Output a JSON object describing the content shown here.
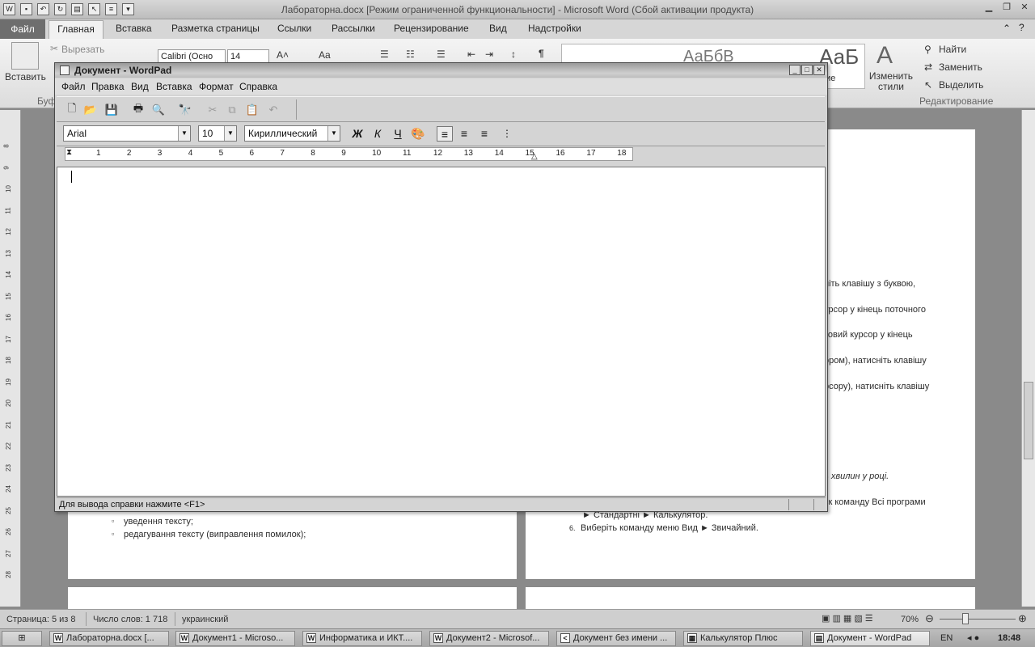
{
  "word": {
    "title": "Лабораторна.docx [Режим ограниченной функциональности]  -  Microsoft Word (Сбой активации продукта)",
    "tabs": [
      "Файл",
      "Главная",
      "Вставка",
      "Разметка страницы",
      "Ссылки",
      "Рассылки",
      "Рецензирование",
      "Вид",
      "Надстройки"
    ],
    "ribbon": {
      "paste": "Вставить",
      "cut": "Вырезать",
      "clipboard_group": "Буф",
      "font_name": "Calibri (Осно",
      "font_size": "14",
      "styles_group_tail": "ние",
      "change_styles": "Изменить стили",
      "find": "Найти",
      "replace": "Заменить",
      "select": "Выделить",
      "editing_group": "Редактирование",
      "style_sample_big": "АаБ"
    },
    "vruler_numbers": [
      "8",
      "9",
      "10",
      "11",
      "12",
      "13",
      "14",
      "15",
      "16",
      "17",
      "18",
      "19",
      "20",
      "21",
      "22",
      "23",
      "24",
      "25",
      "26",
      "27",
      "28"
    ],
    "doc_right_lines": [
      "ніть  клавішу  з  буквою,",
      "урсор у кінець поточного",
      "товий  курсор  у  кінець",
      "ором), натисніть клавішу",
      "рсору), натисніть клавішу"
    ],
    "doc_right_italic": "ь хвилин у році.",
    "doc_right_programs": "ск команду Всі програми",
    "doc_right_calc": "► Стандартні ► Калькулятор.",
    "doc_right_step6_num": "6.",
    "doc_right_step6": "Виберіть команду меню Вид ► Звичайний.",
    "doc_left_bullets": [
      "уведення тексту;",
      "редагування тексту (виправлення помилок);"
    ],
    "status": {
      "page": "Страница: 5 из 8",
      "words": "Число слов: 1 718",
      "language": "украинский",
      "zoom": "70%"
    }
  },
  "wordpad": {
    "title": "Документ - WordPad",
    "menu": [
      "Файл",
      "Правка",
      "Вид",
      "Вставка",
      "Формат",
      "Справка"
    ],
    "font": "Arial",
    "size": "10",
    "script": "Кириллический",
    "bold": "Ж",
    "italic": "К",
    "underline": "Ч",
    "ruler_numbers": [
      "1",
      "2",
      "3",
      "4",
      "5",
      "6",
      "7",
      "8",
      "9",
      "10",
      "11",
      "12",
      "13",
      "14",
      "15",
      "16",
      "17",
      "18"
    ],
    "status_text": "Для вывода справки нажмите <F1>"
  },
  "taskbar": {
    "items": [
      {
        "icon": "W",
        "label": "Лабораторна.docx [..."
      },
      {
        "icon": "W",
        "label": "Документ1 - Microso..."
      },
      {
        "icon": "W",
        "label": "Информатика и ИКТ...."
      },
      {
        "icon": "W",
        "label": "Документ2 - Microsof..."
      },
      {
        "icon": "<",
        "label": "Документ без имени ..."
      },
      {
        "icon": "▦",
        "label": "Калькулятор Плюс"
      },
      {
        "icon": "▤",
        "label": "Документ - WordPad"
      }
    ],
    "lang": "EN",
    "time": "18:48"
  }
}
